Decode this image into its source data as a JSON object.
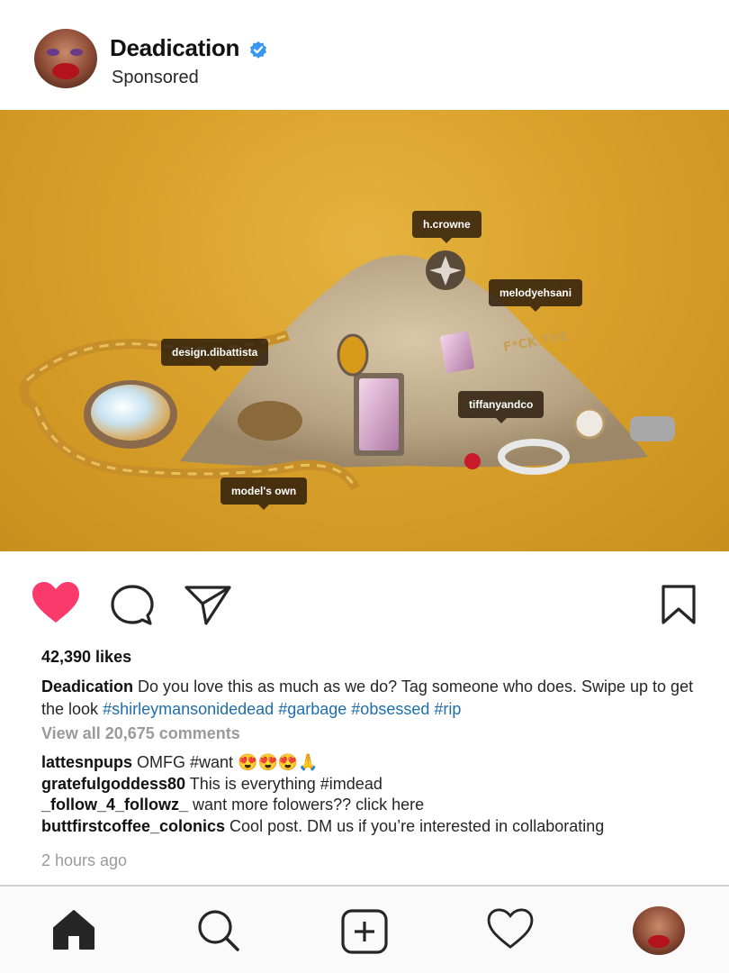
{
  "post": {
    "username": "Deadication",
    "sponsored_label": "Sponsored",
    "verified": true
  },
  "photo": {
    "tags": [
      "h.crowne",
      "melodyehsani",
      "design.dibattista",
      "tiffanyandco",
      "model's own"
    ],
    "background_color": "#d9a12a"
  },
  "actions": {
    "like_icon": "heart-filled-icon",
    "comment_icon": "comment-icon",
    "share_icon": "send-icon",
    "save_icon": "bookmark-icon",
    "like_color": "#fb3a6c"
  },
  "likes_text": "42,390 likes",
  "caption": {
    "username": "Deadication",
    "text": "Do you love this as much as we do? Tag someone who does. Swipe up to get the look",
    "hashtags": [
      "#shirleymansonidedead",
      "#garbage",
      "#obsessed",
      "#rip"
    ]
  },
  "view_all_comments": "View all 20,675 comments",
  "comments": [
    {
      "user": "lattesnpups",
      "text": "OMFG #want 😍😍😍🙏"
    },
    {
      "user": "gratefulgoddess80",
      "text": "This is everything #imdead"
    },
    {
      "user": "_follow_4_followz_",
      "text": "want more folowers??  click here"
    },
    {
      "user": "buttfirstcoffee_colonics",
      "text": "Cool post. DM us if you’re interested in collaborating"
    }
  ],
  "timestamp": "2 hours ago",
  "nav": {
    "items": [
      "home-icon",
      "search-icon",
      "new-post-icon",
      "activity-heart-icon",
      "profile-avatar"
    ]
  }
}
